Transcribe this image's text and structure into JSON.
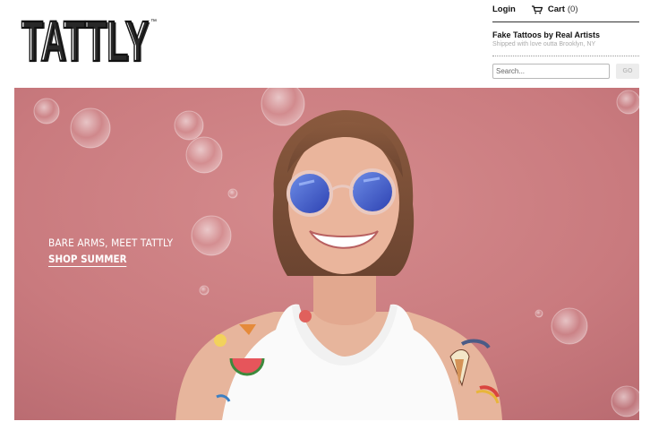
{
  "brand": {
    "logo_text": "TATTLY",
    "trademark": "™"
  },
  "nav": {
    "login_label": "Login",
    "cart_label": "Cart",
    "cart_count": "(0)"
  },
  "header": {
    "tagline": "Fake Tattoos by Real Artists",
    "subtagline": "Shipped with love outta Brooklyn, NY"
  },
  "search": {
    "placeholder": "Search...",
    "value": "",
    "button_label": "GO"
  },
  "hero": {
    "headline": "BARE ARMS, MEET TATTLY",
    "cta_label": "SHOP SUMMER"
  },
  "colors": {
    "hero_background": "#c97a7e",
    "text": "#111111",
    "muted": "#aaaaaa"
  },
  "icons": {
    "cart": "shopping-cart-icon"
  }
}
